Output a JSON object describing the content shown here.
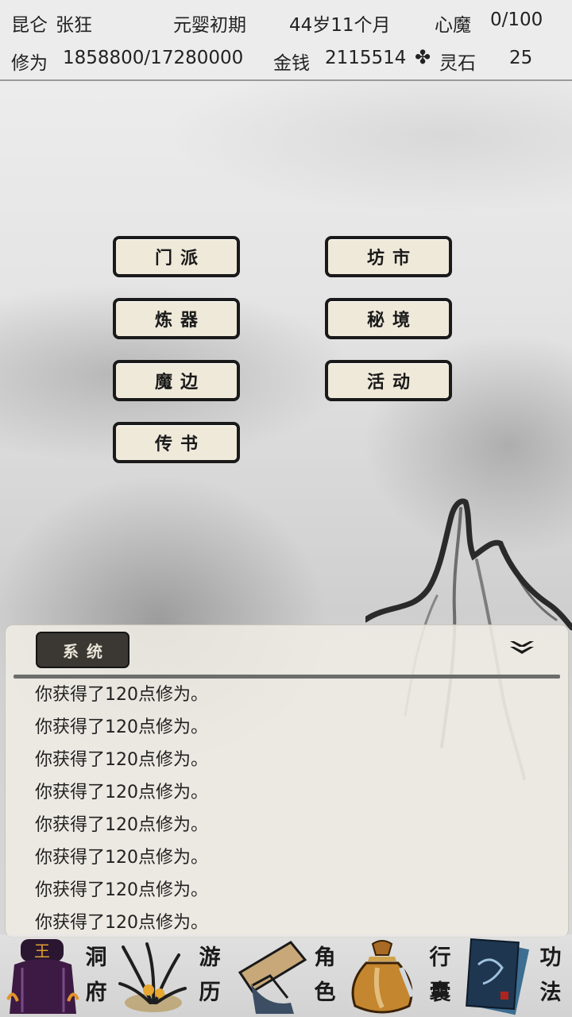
{
  "status": {
    "sect": "昆仑",
    "name": "张狂",
    "realm": "元婴初期",
    "age": "44岁11个月",
    "demon_label": "心魔",
    "demon_value": "0/100",
    "cultivation_label": "修为",
    "cultivation_value": "1858800/17280000",
    "money_label": "金钱",
    "money_value": "2115514",
    "spirit_stone_label": "灵石",
    "spirit_stone_value": "25",
    "separator_icon": "clover-icon"
  },
  "menu": {
    "sect": "门派",
    "market": "坊市",
    "forge": "炼器",
    "secret_realm": "秘境",
    "demon_border": "魔边",
    "activity": "活动",
    "message": "传书"
  },
  "log": {
    "tab_label": "系统",
    "collapse_icon": "double-chevron-down-icon",
    "lines": [
      "你获得了120点修为。",
      "你获得了120点修为。",
      "你获得了120点修为。",
      "你获得了120点修为。",
      "你获得了120点修为。",
      "你获得了120点修为。",
      "你获得了120点修为。",
      "你获得了120点修为。"
    ]
  },
  "nav": {
    "cave": [
      "洞",
      "府"
    ],
    "travel": [
      "游",
      "历"
    ],
    "character": [
      "角",
      "色"
    ],
    "bag": [
      "行",
      "囊"
    ],
    "skills": [
      "功",
      "法"
    ]
  },
  "colors": {
    "button_bg": "#efe9da",
    "button_border": "#1a1a1a",
    "log_tab_bg": "#3b3834"
  }
}
